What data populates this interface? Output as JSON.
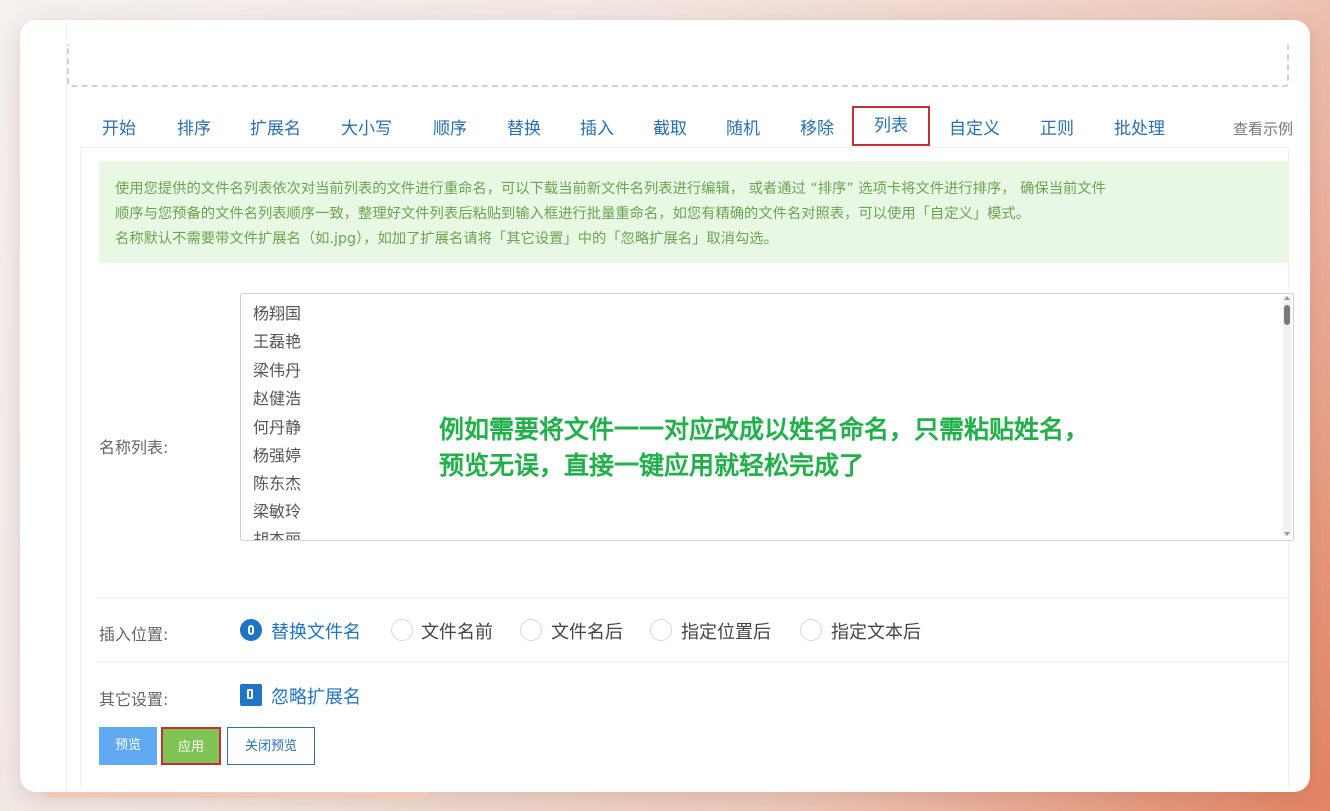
{
  "tabs": {
    "items": [
      "开始",
      "排序",
      "扩展名",
      "大小写",
      "顺序",
      "替换",
      "插入",
      "截取",
      "随机",
      "移除",
      "列表",
      "自定义",
      "正则",
      "批处理"
    ],
    "active": "列表",
    "example_link": "查看示例"
  },
  "notice": {
    "line1": "使用您提供的文件名列表依次对当前列表的文件进行重命名，可以下载当前新文件名列表进行编辑， 或者通过 “排序” 选项卡将文件进行排序， 确保当前文件",
    "line2": "顺序与您预备的文件名列表顺序一致，整理好文件列表后粘贴到输入框进行批量重命名，如您有精确的文件名对照表，可以使用「自定义」模式。",
    "line3": "名称默认不需要带文件扩展名（如.jpg），如加了扩展名请将「其它设置」中的「忽略扩展名」取消勾选。"
  },
  "name_list": {
    "label": "名称列表:",
    "names": [
      "杨翔国",
      "王磊艳",
      "梁伟丹",
      "赵健浩",
      "何丹静",
      "杨强婷",
      "陈东杰",
      "梁敏玲",
      "胡杰丽"
    ]
  },
  "annotation": {
    "line1": "例如需要将文件一一对应改成以姓名命名，只需粘贴姓名，",
    "line2": "预览无误，直接一键应用就轻松完成了"
  },
  "insert_position": {
    "label": "插入位置:",
    "options": [
      "替换文件名",
      "文件名前",
      "文件名后",
      "指定位置后",
      "指定文本后"
    ],
    "selected": "替换文件名"
  },
  "other_settings": {
    "label": "其它设置:",
    "ignore_ext_label": "忽略扩展名",
    "ignore_ext_checked": true
  },
  "buttons": {
    "preview": "预览",
    "apply": "应用",
    "close_preview": "关闭预览"
  }
}
